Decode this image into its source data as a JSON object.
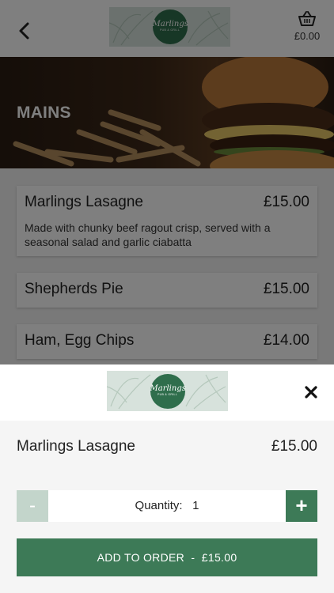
{
  "header": {
    "logo_text": "Marlings",
    "logo_sub": "PUB & GRILL",
    "basket_total": "£0.00"
  },
  "category": {
    "title": "MAINS"
  },
  "menu_items": [
    {
      "name": "Marlings Lasagne",
      "price": "£15.00",
      "description": "Made with chunky beef ragout crisp, served with a seasonal salad and garlic ciabatta"
    },
    {
      "name": "Shepherds Pie",
      "price": "£15.00"
    },
    {
      "name": "Ham, Egg Chips",
      "price": "£14.00"
    }
  ],
  "sheet": {
    "item_name": "Marlings Lasagne",
    "item_price": "£15.00",
    "quantity_label": "Quantity:",
    "quantity_value": "1",
    "minus_label": "-",
    "plus_label": "+",
    "add_label": "ADD TO ORDER",
    "add_separator": "-",
    "add_total": "£15.00"
  },
  "colors": {
    "brand_green": "#3d7a57",
    "light_green": "#c3d5cb"
  },
  "icons": [
    "back-chevron-icon",
    "basket-icon",
    "close-icon"
  ]
}
